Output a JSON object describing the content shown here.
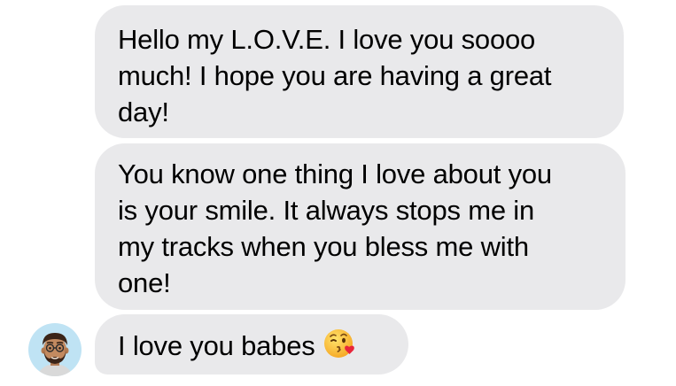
{
  "conversation": {
    "messages": [
      {
        "sender": "them",
        "lines": [
          "Hello my L.O.V.E. I love you soooo",
          "much! I hope you are having a great",
          "day!"
        ]
      },
      {
        "sender": "them",
        "lines": [
          "You know one thing I love about you",
          "is your smile.  It always stops me in",
          "my tracks when you bless me with",
          "one!"
        ]
      },
      {
        "sender": "them",
        "text": "I love you babes",
        "emoji": "face-blowing-a-kiss-icon"
      }
    ],
    "avatar": {
      "icon": "memoji-avatar-icon"
    }
  },
  "colors": {
    "bubble_background": "#e9e9eb",
    "text": "#000000",
    "avatar_background": "#bfe3f4",
    "page_background": "#ffffff"
  }
}
